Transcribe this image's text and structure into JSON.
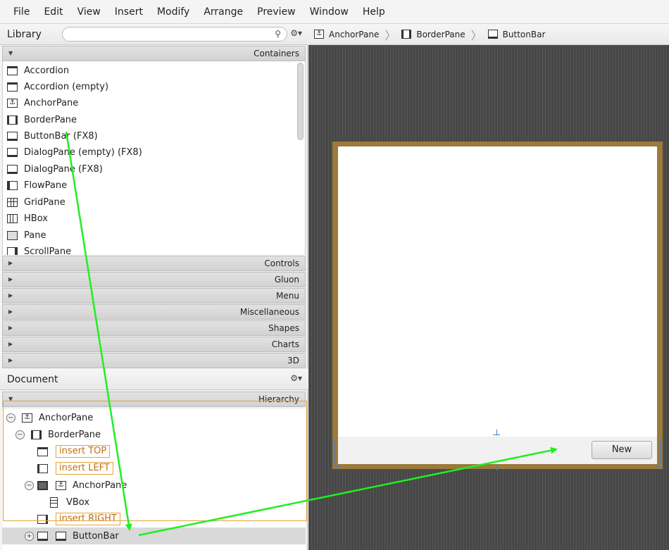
{
  "menubar": [
    "File",
    "Edit",
    "View",
    "Insert",
    "Modify",
    "Arrange",
    "Preview",
    "Window",
    "Help"
  ],
  "library": {
    "title": "Library",
    "search_placeholder": "",
    "open_section": "Containers",
    "items": [
      {
        "label": "Accordion",
        "icon": "accordion-icon"
      },
      {
        "label": "Accordion  (empty)",
        "icon": "accordion-icon"
      },
      {
        "label": "AnchorPane",
        "icon": "anchor-pane-icon"
      },
      {
        "label": "BorderPane",
        "icon": "border-pane-icon"
      },
      {
        "label": "ButtonBar  (FX8)",
        "icon": "button-bar-icon"
      },
      {
        "label": "DialogPane (empty)  (FX8)",
        "icon": "dialog-pane-icon"
      },
      {
        "label": "DialogPane  (FX8)",
        "icon": "dialog-pane-icon"
      },
      {
        "label": "FlowPane",
        "icon": "flow-pane-icon"
      },
      {
        "label": "GridPane",
        "icon": "grid-pane-icon"
      },
      {
        "label": "HBox",
        "icon": "hbox-icon"
      },
      {
        "label": "Pane",
        "icon": "pane-icon"
      },
      {
        "label": "ScrollPane",
        "icon": "scroll-pane-icon"
      }
    ],
    "collapsed_sections": [
      "Controls",
      "Gluon",
      "Menu",
      "Miscellaneous",
      "Shapes",
      "Charts",
      "3D"
    ]
  },
  "document": {
    "title": "Document",
    "section": "Hierarchy",
    "tree": {
      "anchorpane_root": "AnchorPane",
      "borderpane": "BorderPane",
      "insert_top": "insert TOP",
      "insert_left": "insert LEFT",
      "anchorpane_child": "AnchorPane",
      "vbox": "VBox",
      "insert_right": "insert RIGHT",
      "buttonbar": "ButtonBar"
    }
  },
  "breadcrumb": [
    "AnchorPane",
    "BorderPane",
    "ButtonBar"
  ],
  "canvas": {
    "new_button": "New"
  },
  "colors": {
    "accent_orange": "#e6a23c",
    "arrow_green": "#22ee22",
    "stage_border": "#9b7a3c"
  }
}
